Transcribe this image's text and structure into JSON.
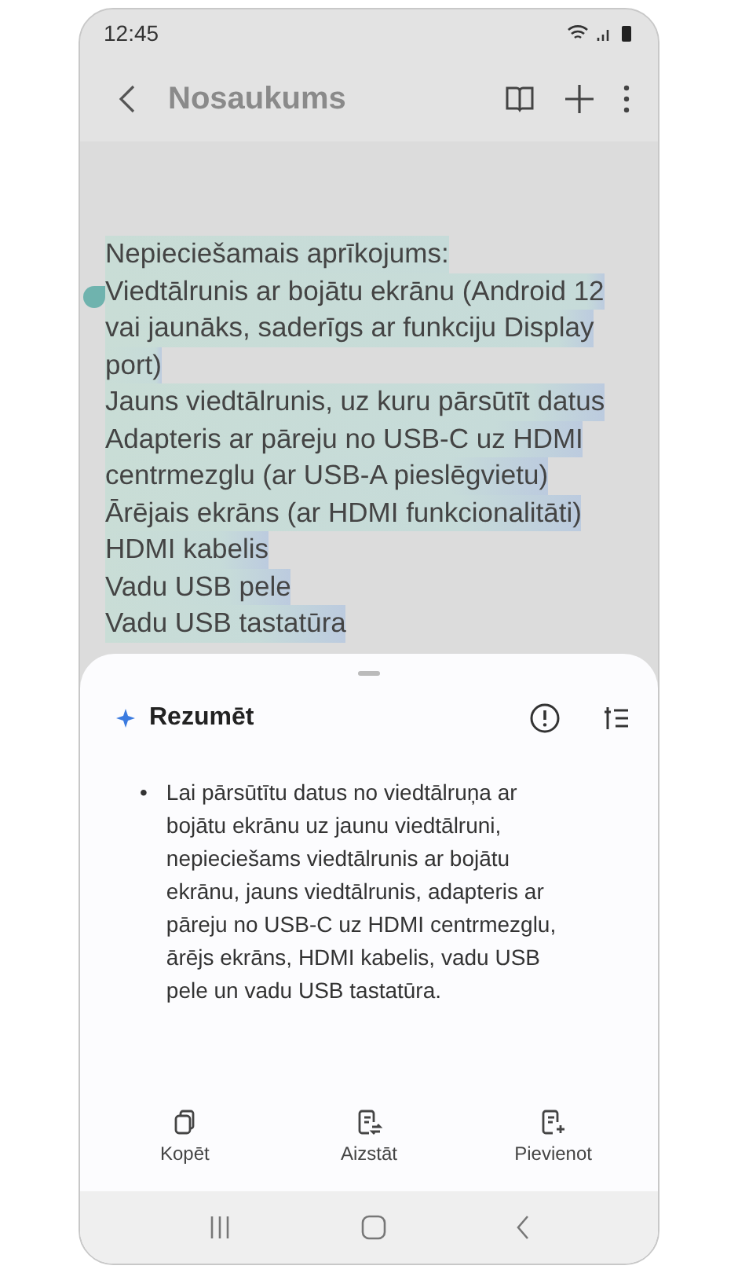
{
  "status_bar": {
    "time": "12:45"
  },
  "header": {
    "title": "Nosaukums"
  },
  "note": {
    "selected": true,
    "lines": [
      "Nepieciešamais aprīkojums:",
      "Viedtālrunis ar bojātu ekrānu (Android 12",
      "vai jaunāks, saderīgs ar funkciju Display",
      "port)",
      "Jauns viedtālrunis, uz kuru pārsūtīt datus",
      "Adapteris ar pāreju no USB-C uz HDMI",
      "centrmezglu (ar USB-A pieslēgvietu)",
      "Ārējais ekrāns (ar HDMI funkcionalitāti)",
      "HDMI kabelis",
      "Vadu USB pele",
      "Vadu USB tastatūra"
    ]
  },
  "summary": {
    "title": "Rezumēt",
    "bullet": "•",
    "bullets": [
      "Lai pārsūtītu datus no viedtālruņa ar bojātu ekrānu uz jaunu viedtālruni, nepieciešams viedtālrunis ar bojātu ekrānu, jauns viedtālrunis, adapteris ar pāreju no USB-C uz HDMI centrmezglu, ārējs ekrāns, HDMI kabelis, vadu USB pele un vadu USB tastatūra."
    ],
    "actions": [
      {
        "kind": "copy",
        "label": "Kopēt"
      },
      {
        "kind": "replace",
        "label": "Aizstāt"
      },
      {
        "kind": "add",
        "label": "Pievienot"
      }
    ]
  }
}
